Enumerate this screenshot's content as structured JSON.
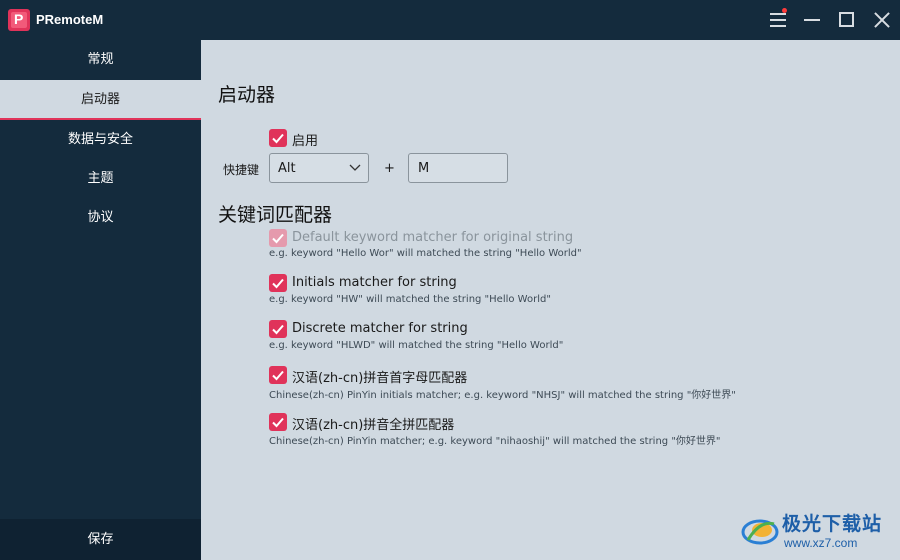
{
  "app": {
    "logo_letter": "P",
    "title": "PRemoteM"
  },
  "sidebar": {
    "items": [
      {
        "label": "常规"
      },
      {
        "label": "启动器"
      },
      {
        "label": "数据与安全"
      },
      {
        "label": "主题"
      },
      {
        "label": "协议"
      }
    ],
    "active_index": 1,
    "save_label": "保存"
  },
  "launcher": {
    "title": "启动器",
    "enable_label": "启用",
    "enable_checked": true,
    "hotkey_label": "快捷键",
    "modifier_value": "Alt",
    "plus": "+",
    "key_value": "M"
  },
  "matcher": {
    "title": "关键词匹配器",
    "items": [
      {
        "label": "Default keyword matcher for original string",
        "hint": "e.g. keyword \"Hello Wor\" will matched the string \"Hello World\"",
        "checked": true,
        "disabled": true
      },
      {
        "label": "Initials matcher for string",
        "hint": "e.g. keyword \"HW\" will matched the string \"Hello World\"",
        "checked": true,
        "disabled": false
      },
      {
        "label": "Discrete matcher for string",
        "hint": "e.g. keyword \"HLWD\" will matched the string \"Hello World\"",
        "checked": true,
        "disabled": false
      },
      {
        "label": "汉语(zh-cn)拼音首字母匹配器",
        "hint": "Chinese(zh-cn) PinYin initials matcher; e.g. keyword \"NHSJ\" will matched the string \"你好世界\"",
        "checked": true,
        "disabled": false
      },
      {
        "label": "汉语(zh-cn)拼音全拼匹配器",
        "hint": "Chinese(zh-cn) PinYin matcher; e.g. keyword \"nihaoshij\" will matched the string \"你好世界\"",
        "checked": true,
        "disabled": false
      }
    ]
  },
  "watermark": {
    "text": "极光下载站",
    "url": "www.xz7.com"
  },
  "colors": {
    "accent": "#e0335a",
    "sidebar_bg": "#142b3d",
    "content_bg": "#d0d9e1"
  }
}
